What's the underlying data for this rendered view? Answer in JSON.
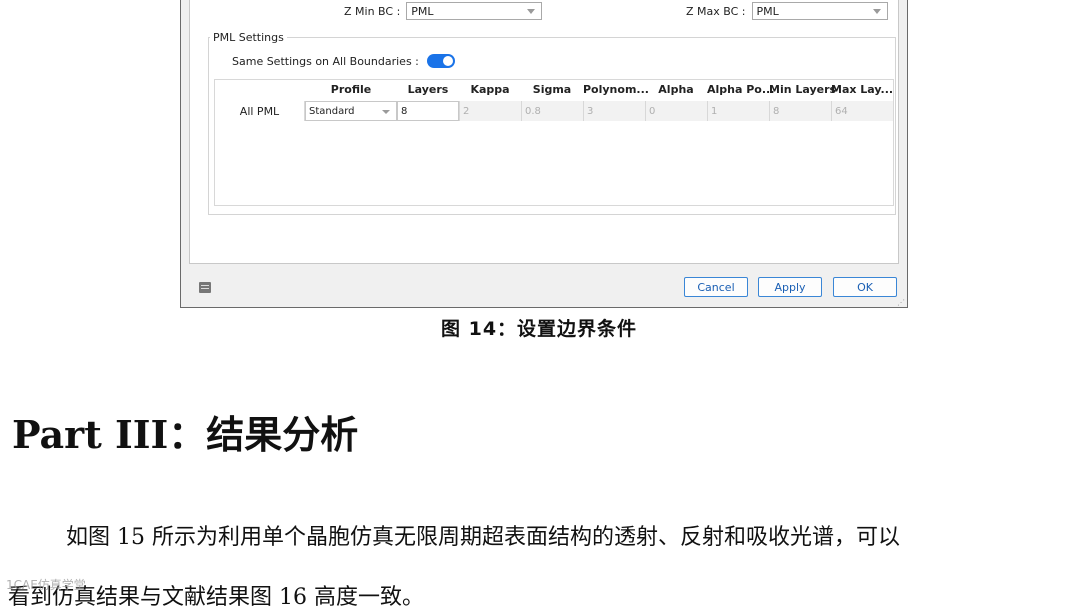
{
  "dialog": {
    "z_min_label": "Z Min BC :",
    "z_min_value": "PML",
    "z_max_label": "Z Max BC :",
    "z_max_value": "PML",
    "pml_group_title": "PML Settings",
    "same_settings_label": "Same Settings on All Boundaries :",
    "same_settings_on": true,
    "table": {
      "headers": [
        "Profile",
        "Layers",
        "Kappa",
        "Sigma",
        "Polynom...",
        "Alpha",
        "Alpha Po...",
        "Min Layers",
        "Max Lay..."
      ],
      "row_label": "All PML",
      "profile": "Standard",
      "layers": "8",
      "kappa": "2",
      "sigma": "0.8",
      "polynom": "3",
      "alpha": "0",
      "alpha_po": "1",
      "min_layers": "8",
      "max_layers": "64"
    },
    "buttons": {
      "cancel": "Cancel",
      "apply": "Apply",
      "ok": "OK"
    },
    "accent_color": "#1a73e8"
  },
  "document": {
    "figure_caption": "图 14：设置边界条件",
    "heading": "Part III：结果分析",
    "paragraph_line1": "如图 15 所示为利用单个晶胞仿真无限周期超表面结构的透射、反射和吸收光谱，可以",
    "paragraph_line2": "看到仿真结果与文献结果图 16 高度一致。",
    "watermark": "1CAE仿真学堂"
  }
}
